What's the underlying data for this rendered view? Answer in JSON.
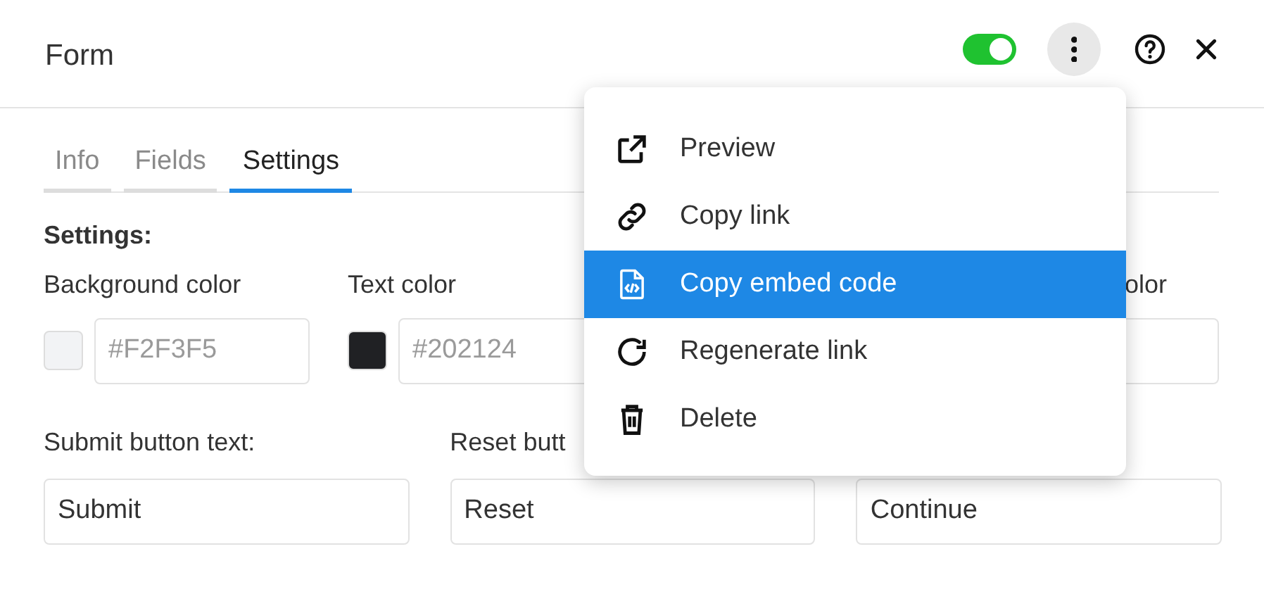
{
  "header": {
    "title": "Form",
    "toggle": {
      "on": true
    }
  },
  "tabs": [
    {
      "label": "Info",
      "selected": false
    },
    {
      "label": "Fields",
      "selected": false
    },
    {
      "label": "Settings",
      "selected": true
    }
  ],
  "settings": {
    "heading": "Settings:",
    "color_fields": [
      {
        "label": "Background color",
        "color": "#f2f3f5",
        "placeholder": "#F2F3F5"
      },
      {
        "label": "Text color",
        "color": "#202124",
        "placeholder": "#202124"
      },
      {
        "label": "olor"
      }
    ],
    "text_fields": [
      {
        "label": "Submit button text:",
        "value": "Submit"
      },
      {
        "label": "Reset butt",
        "value": "Reset"
      },
      {
        "value": "Continue"
      }
    ]
  },
  "menu": {
    "items": [
      {
        "kind": "external",
        "label": "Preview",
        "selected": false
      },
      {
        "kind": "link",
        "label": "Copy link",
        "selected": false
      },
      {
        "kind": "code",
        "label": "Copy embed code",
        "selected": true
      },
      {
        "kind": "refresh",
        "label": "Regenerate link",
        "selected": false
      },
      {
        "kind": "trash",
        "label": "Delete",
        "selected": false
      }
    ]
  }
}
